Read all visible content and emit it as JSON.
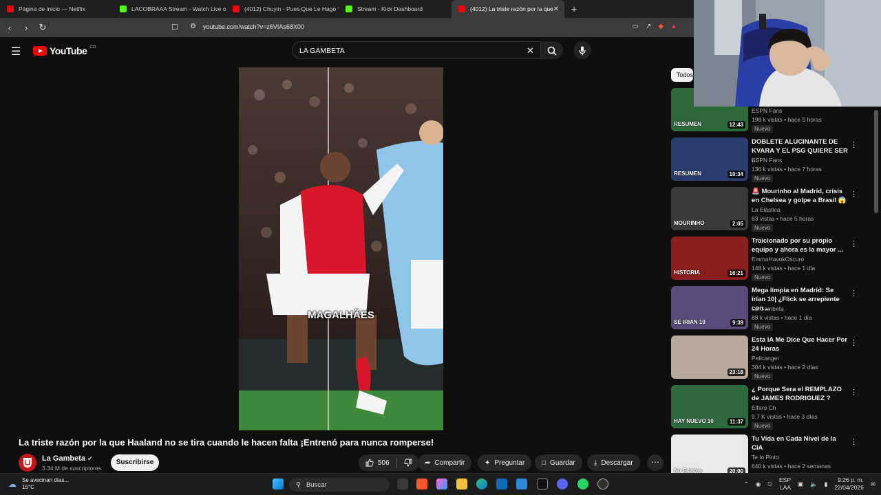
{
  "browser": {
    "tabs": [
      {
        "title": "Página de inicio — Netflix",
        "color": "#e50914"
      },
      {
        "title": "LACOBRAAA Stream - Watch Live on",
        "color": "#53fc18"
      },
      {
        "title": "(4012) Chuyin - Pues Que Le Hago ?",
        "color": "#ff0000"
      },
      {
        "title": "Stream - Kick Dashboard",
        "color": "#53fc18"
      },
      {
        "title": "(4012) La triste razón por la que",
        "color": "#ff0000"
      }
    ],
    "new_tab": "+",
    "url": "youtube.com/watch?v=z6VIAs68X00"
  },
  "youtube": {
    "logo_text": "YouTube",
    "logo_region": "CO",
    "search_value": "LA GAMBETA",
    "video_caption": "MAGALHÃES",
    "video_title": "La triste razón por la que Haaland no se tira cuando le hacen falta ¡Entrenó para nunca romperse!",
    "channel": {
      "name": "La Gambeta",
      "subs": "3.34 M de suscriptores",
      "subscribe": "Suscribirse"
    },
    "actions": {
      "likes": "506",
      "share": "Compartir",
      "ask": "Preguntar",
      "save": "Guardar",
      "download": "Descargar"
    },
    "chip": "Todos",
    "related": [
      {
        "title": "",
        "channel": "ESPN Fans",
        "meta": "198 k vistas • hace 5 horas",
        "badge": "Nuevo",
        "duration": "12:43",
        "thumb_label": "RESUMEN",
        "color": "#2d6a3a"
      },
      {
        "title": "DOBLETE ALUCINANTE DE KVARA Y EL PSG QUIERE SER ...",
        "channel": "ESPN Fans",
        "meta": "136 k vistas • hace 7 horas",
        "badge": "Nuevo",
        "duration": "10:34",
        "thumb_label": "RESUMEN",
        "color": "#2a3b6e"
      },
      {
        "title": "🚨 Mourinho al Madrid, crisis en Chelsea y golpe a Brasil 😱",
        "channel": "La Elástica",
        "meta": "63 vistas • hace 5 horas",
        "badge": "Nuevo",
        "duration": "2:05",
        "thumb_label": "MOURINHO",
        "color": "#3a3a3a"
      },
      {
        "title": "Traicionado por su propio equipo y ahora es la mayor ...",
        "channel": "EmmaHavokOscuro",
        "meta": "148 k vistas • hace 1 día",
        "badge": "Nuevo",
        "duration": "16:21",
        "thumb_label": "HISTORIA",
        "color": "#8b1e1e"
      },
      {
        "title": "Mega limpia en Madrid: Se irían 10| ¿Flick se arrepiente con ...",
        "channel": "La Gambeta",
        "meta": "88 k vistas • hace 1 día",
        "badge": "Nuevo",
        "duration": "9:39",
        "thumb_label": "SE IRIAN 10",
        "color": "#5a4a7a"
      },
      {
        "title": "Esta IA Me Dice Que Hacer Por 24 Horas",
        "channel": "Pelicanger",
        "meta": "304 k vistas • hace 2 días",
        "badge": "Nuevo",
        "duration": "23:18",
        "thumb_label": "",
        "color": "#b8a89a"
      },
      {
        "title": "¿ Porque Sera el REMPLAZO de JAMES RODRIGUEZ ?",
        "channel": "Elfaro Ch",
        "meta": "9.7 K vistas • hace 3 días",
        "badge": "Nuevo",
        "duration": "11:37",
        "thumb_label": "HAY NUEVO 10",
        "color": "#2f6a3e"
      },
      {
        "title": "Tu Vida en Cada Nivel de la CIA",
        "channel": "Te lo Pinto",
        "meta": "640 k vistas • hace 2 semanas",
        "badge": "",
        "duration": "20:00",
        "thumb_label": "No Existes",
        "color": "#e8e8e8"
      }
    ]
  },
  "taskbar": {
    "weather_line1": "Se avecinan días...",
    "weather_line2": "15°C",
    "search": "Buscar",
    "lang1": "ESP",
    "lang2": "LAA",
    "time": "9:26 p. m.",
    "date": "22/04/2026"
  }
}
